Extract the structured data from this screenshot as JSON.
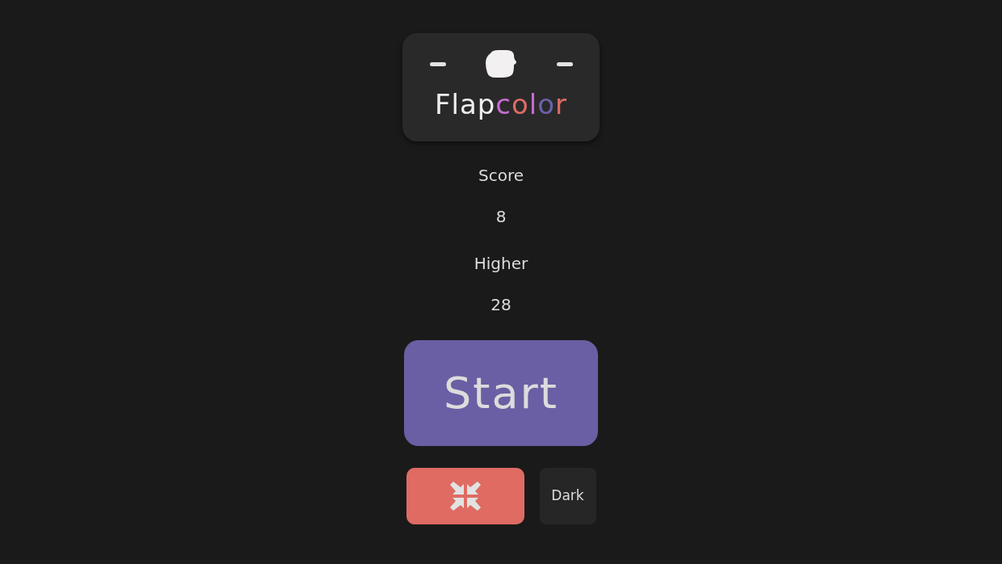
{
  "logo": {
    "title": [
      {
        "text": "Flap",
        "color": "#eeeeee"
      },
      {
        "text": "c",
        "color": "#c56cd2"
      },
      {
        "text": "o",
        "color": "#df6b66"
      },
      {
        "text": "l",
        "color": "#c56cd2"
      },
      {
        "text": "o",
        "color": "#6b62ae"
      },
      {
        "text": "r",
        "color": "#df6b66"
      }
    ]
  },
  "stats": [
    {
      "label": "Score",
      "value": "8"
    },
    {
      "label": "Higher",
      "value": "28"
    }
  ],
  "start_button": {
    "label": "Start"
  },
  "controls": [
    {
      "kind": "collapse"
    },
    {
      "kind": "theme",
      "label": "Dark"
    }
  ]
}
